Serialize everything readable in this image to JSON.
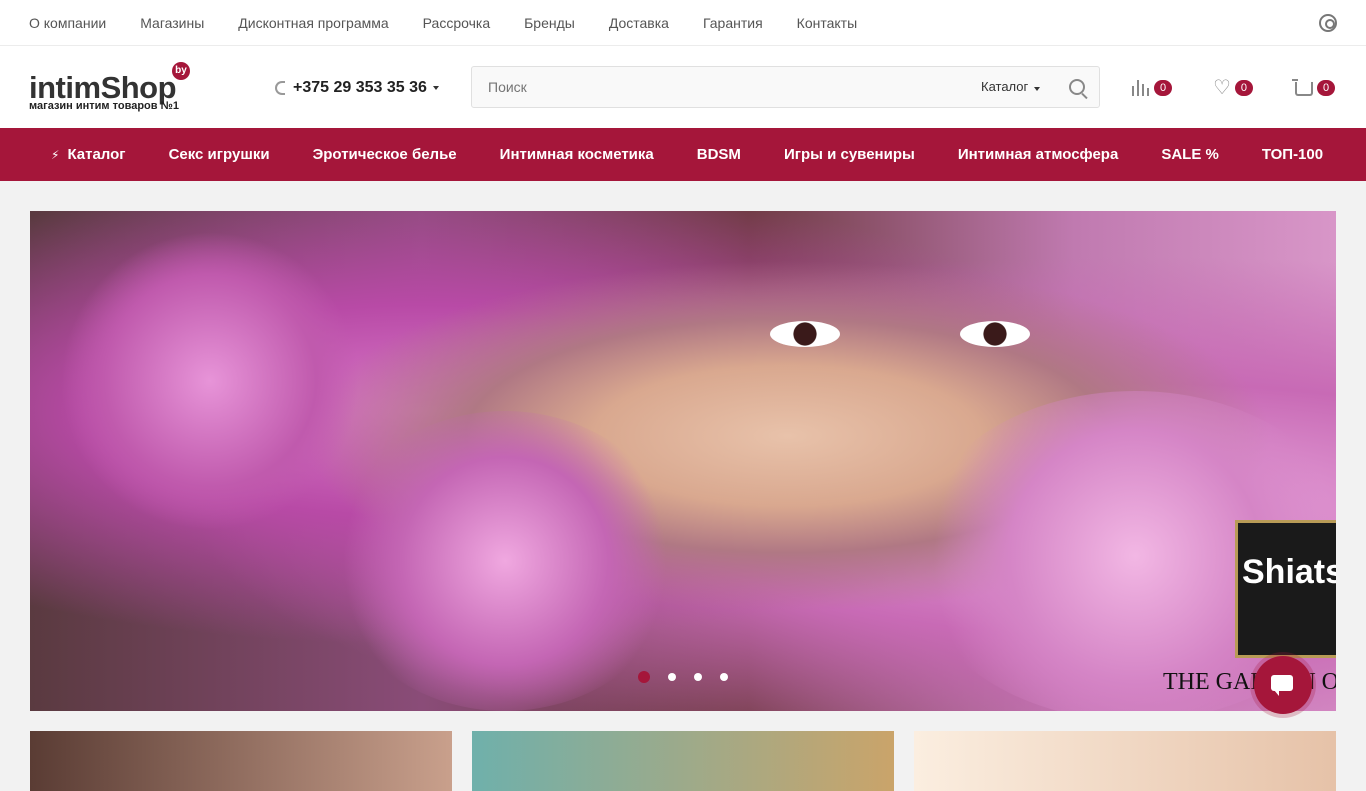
{
  "topbar": {
    "links": [
      "О компании",
      "Магазины",
      "Дисконтная программа",
      "Рассрочка",
      "Бренды",
      "Доставка",
      "Гарантия",
      "Контакты"
    ],
    "user_icon": "user-circle-icon"
  },
  "header": {
    "logo_main_a": "intim",
    "logo_main_b": "Shop",
    "logo_badge": "by",
    "logo_sub": "магазин интим товаров №1",
    "phone": "+375 29 353 35 36",
    "search_placeholder": "Поиск",
    "search_category": "Каталог",
    "compare_count": "0",
    "favorites_count": "0",
    "cart_count": "0"
  },
  "nav": {
    "items": [
      "Каталог",
      "Секс игрушки",
      "Эротическое белье",
      "Интимная косметика",
      "BDSM",
      "Игры и сувениры",
      "Интимная атмосфера",
      "SALE %",
      "ТОП-100"
    ]
  },
  "banner": {
    "side_text": "Shiatsu",
    "side_bottom": "THE GARDEN OF"
  },
  "colors": {
    "accent": "#a5163a",
    "topbar_text": "#555555"
  }
}
